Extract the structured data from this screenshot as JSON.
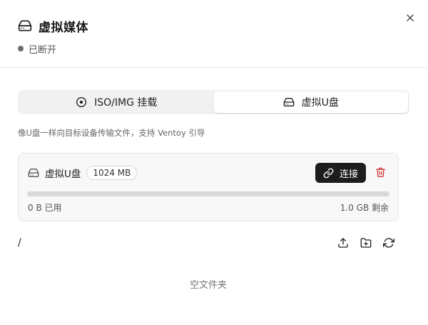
{
  "dialog": {
    "title": "虚拟媒体",
    "status": "已断开",
    "title_icon": "hard-drive-icon",
    "close_icon": "close-icon"
  },
  "tabs": [
    {
      "label": "ISO/IMG 挂载",
      "icon": "disc-icon",
      "active": false
    },
    {
      "label": "虚拟U盘",
      "icon": "hard-drive-icon",
      "active": true
    }
  ],
  "description": "像U盘一样向目标设备传输文件，支持 Ventoy 引导",
  "usb_card": {
    "name": "虚拟U盘",
    "size": "1024 MB",
    "connect_label": "连接",
    "used": "0 B 已用",
    "remaining": "1.0 GB 剩余",
    "usage_fraction": 0.0
  },
  "file_browser": {
    "path": "/",
    "empty_text": "空文件夹",
    "tools": [
      "upload-icon",
      "new-folder-icon",
      "refresh-icon"
    ]
  },
  "colors": {
    "primary_button": "#1d1d1d",
    "delete": "#d32f2f",
    "status_dot": "#6b6b6b"
  }
}
